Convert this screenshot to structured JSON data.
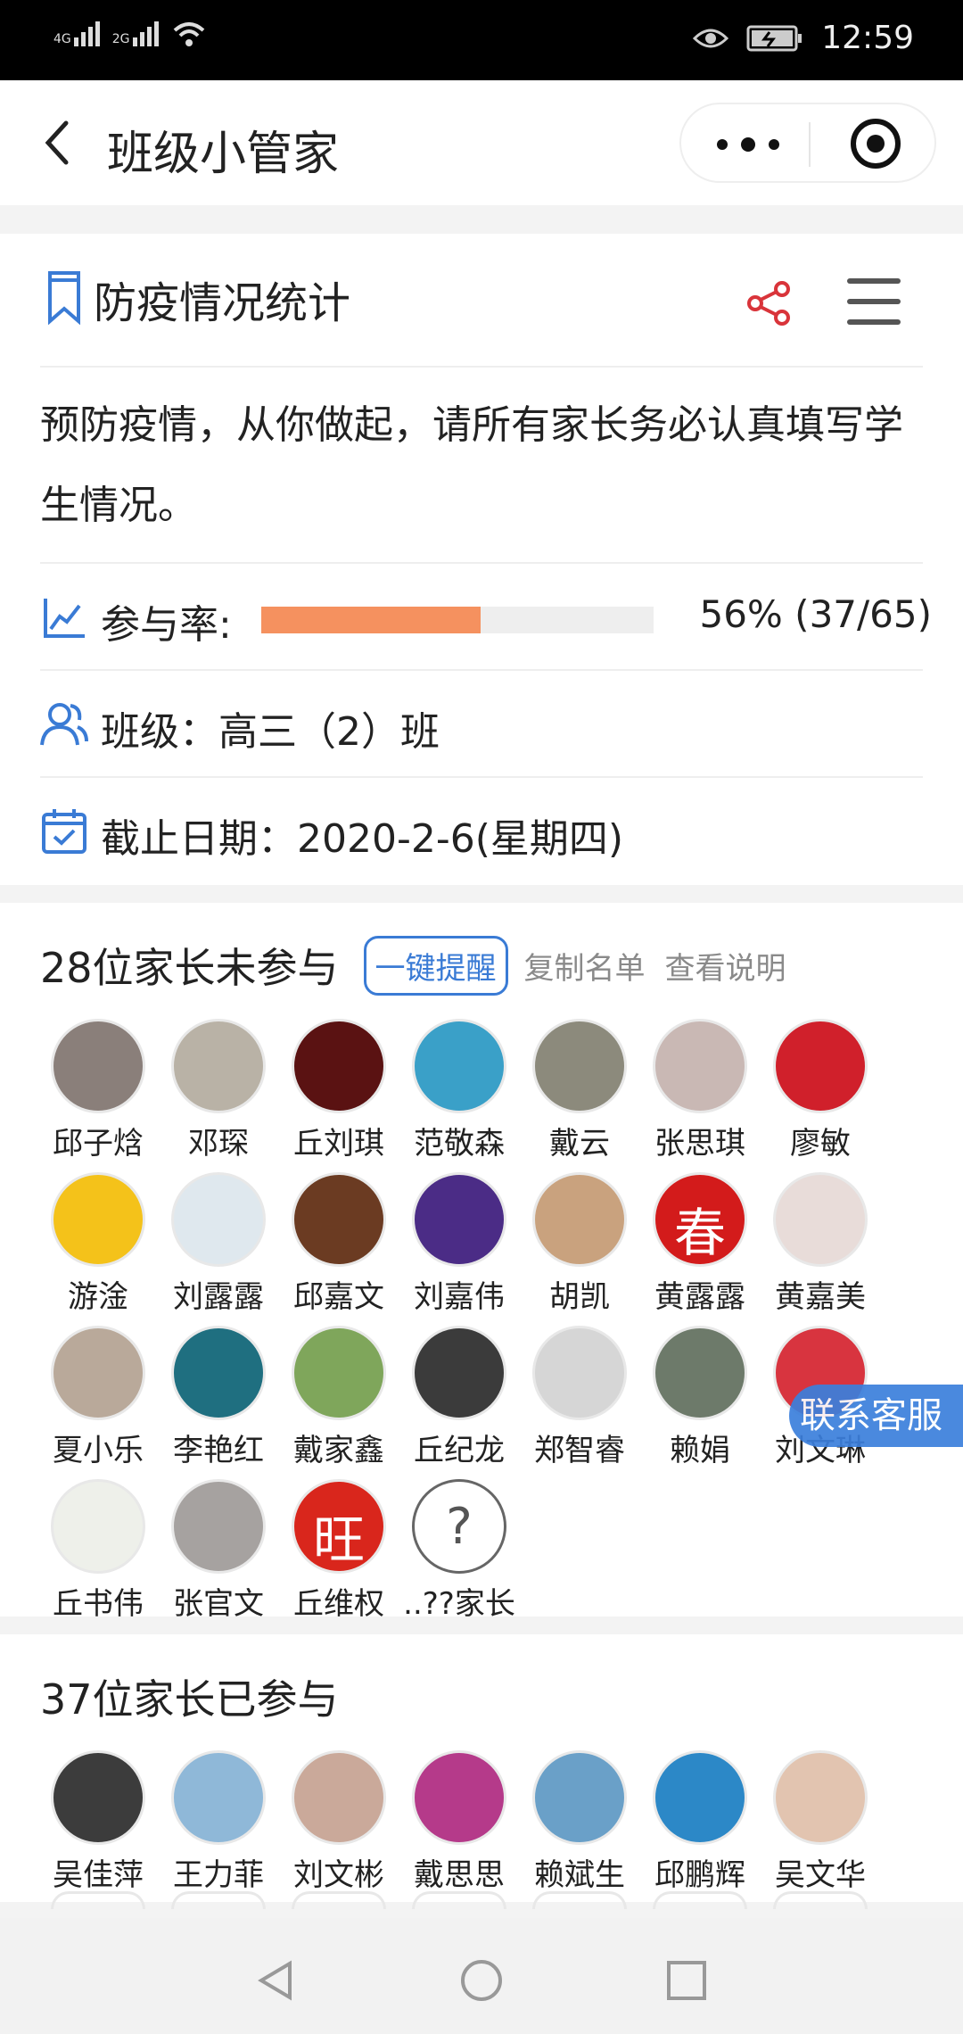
{
  "status_bar": {
    "network1": "4G",
    "network2": "2G",
    "time": "12:59"
  },
  "nav": {
    "title": "班级小管家"
  },
  "survey": {
    "title": "防疫情况统计",
    "description": "预防疫情，从你做起，请所有家长务必认真填写学生情况。",
    "rate_label": "参与率:",
    "rate_fraction": 0.56,
    "rate_text": "56% (37/65)",
    "class_label": "班级：高三（2）班",
    "deadline_label": "截止日期：2020-2-6(星期四)"
  },
  "not_participated": {
    "title": "28位家长未参与",
    "remind_button": "一键提醒",
    "copy_button": "复制名单",
    "help_button": "查看说明",
    "people": [
      {
        "name": "邱子焓",
        "avatar_color": "#8a7f7a"
      },
      {
        "name": "邓琛",
        "avatar_color": "#b9b2a6"
      },
      {
        "name": "丘刘琪",
        "avatar_color": "#5a1212"
      },
      {
        "name": "范敬森",
        "avatar_color": "#3aa0c8"
      },
      {
        "name": "戴云",
        "avatar_color": "#8c8a7c"
      },
      {
        "name": "张思琪",
        "avatar_color": "#c9b8b4"
      },
      {
        "name": "廖敏",
        "avatar_color": "#d0202b"
      },
      {
        "name": "游淦",
        "avatar_color": "#f4c21a"
      },
      {
        "name": "刘露露",
        "avatar_color": "#dfe8ee"
      },
      {
        "name": "邱嘉文",
        "avatar_color": "#6b3b22"
      },
      {
        "name": "刘嘉伟",
        "avatar_color": "#4b2c86"
      },
      {
        "name": "胡凯",
        "avatar_color": "#c9a27e"
      },
      {
        "name": "黄露露",
        "avatar_color": "#d31b1b",
        "avatar_text": "春"
      },
      {
        "name": "黄嘉美",
        "avatar_color": "#e8dcd9"
      },
      {
        "name": "夏小乐",
        "avatar_color": "#b9a99a"
      },
      {
        "name": "李艳红",
        "avatar_color": "#1f6f80"
      },
      {
        "name": "戴家鑫",
        "avatar_color": "#7fa65b"
      },
      {
        "name": "丘纪龙",
        "avatar_color": "#3b3b3b"
      },
      {
        "name": "郑智睿",
        "avatar_color": "#d6d6d6"
      },
      {
        "name": "赖娟",
        "avatar_color": "#6d7a6a"
      },
      {
        "name": "刘文琳",
        "avatar_color": "#d8343f"
      },
      {
        "name": "丘书伟",
        "avatar_color": "#eef0ea"
      },
      {
        "name": "张官文",
        "avatar_color": "#a6a2a0"
      },
      {
        "name": "丘维权",
        "avatar_color": "#d9261c",
        "avatar_text": "旺"
      },
      {
        "name": "..??家长",
        "avatar_color": "#ffffff",
        "unknown": true,
        "avatar_text": "?"
      }
    ]
  },
  "participated": {
    "title": "37位家长已参与",
    "people": [
      {
        "name": "吴佳萍",
        "avatar_color": "#3c3c3c"
      },
      {
        "name": "王力菲",
        "avatar_color": "#8fb8d8"
      },
      {
        "name": "刘文彬",
        "avatar_color": "#caa99a"
      },
      {
        "name": "戴思思",
        "avatar_color": "#b53a8a"
      },
      {
        "name": "赖斌生",
        "avatar_color": "#6aa0c8"
      },
      {
        "name": "邱鹏辉",
        "avatar_color": "#2c88c7"
      },
      {
        "name": "吴文华",
        "avatar_color": "#e2c4b0"
      }
    ]
  },
  "customer_service": {
    "label": "联系客服"
  }
}
